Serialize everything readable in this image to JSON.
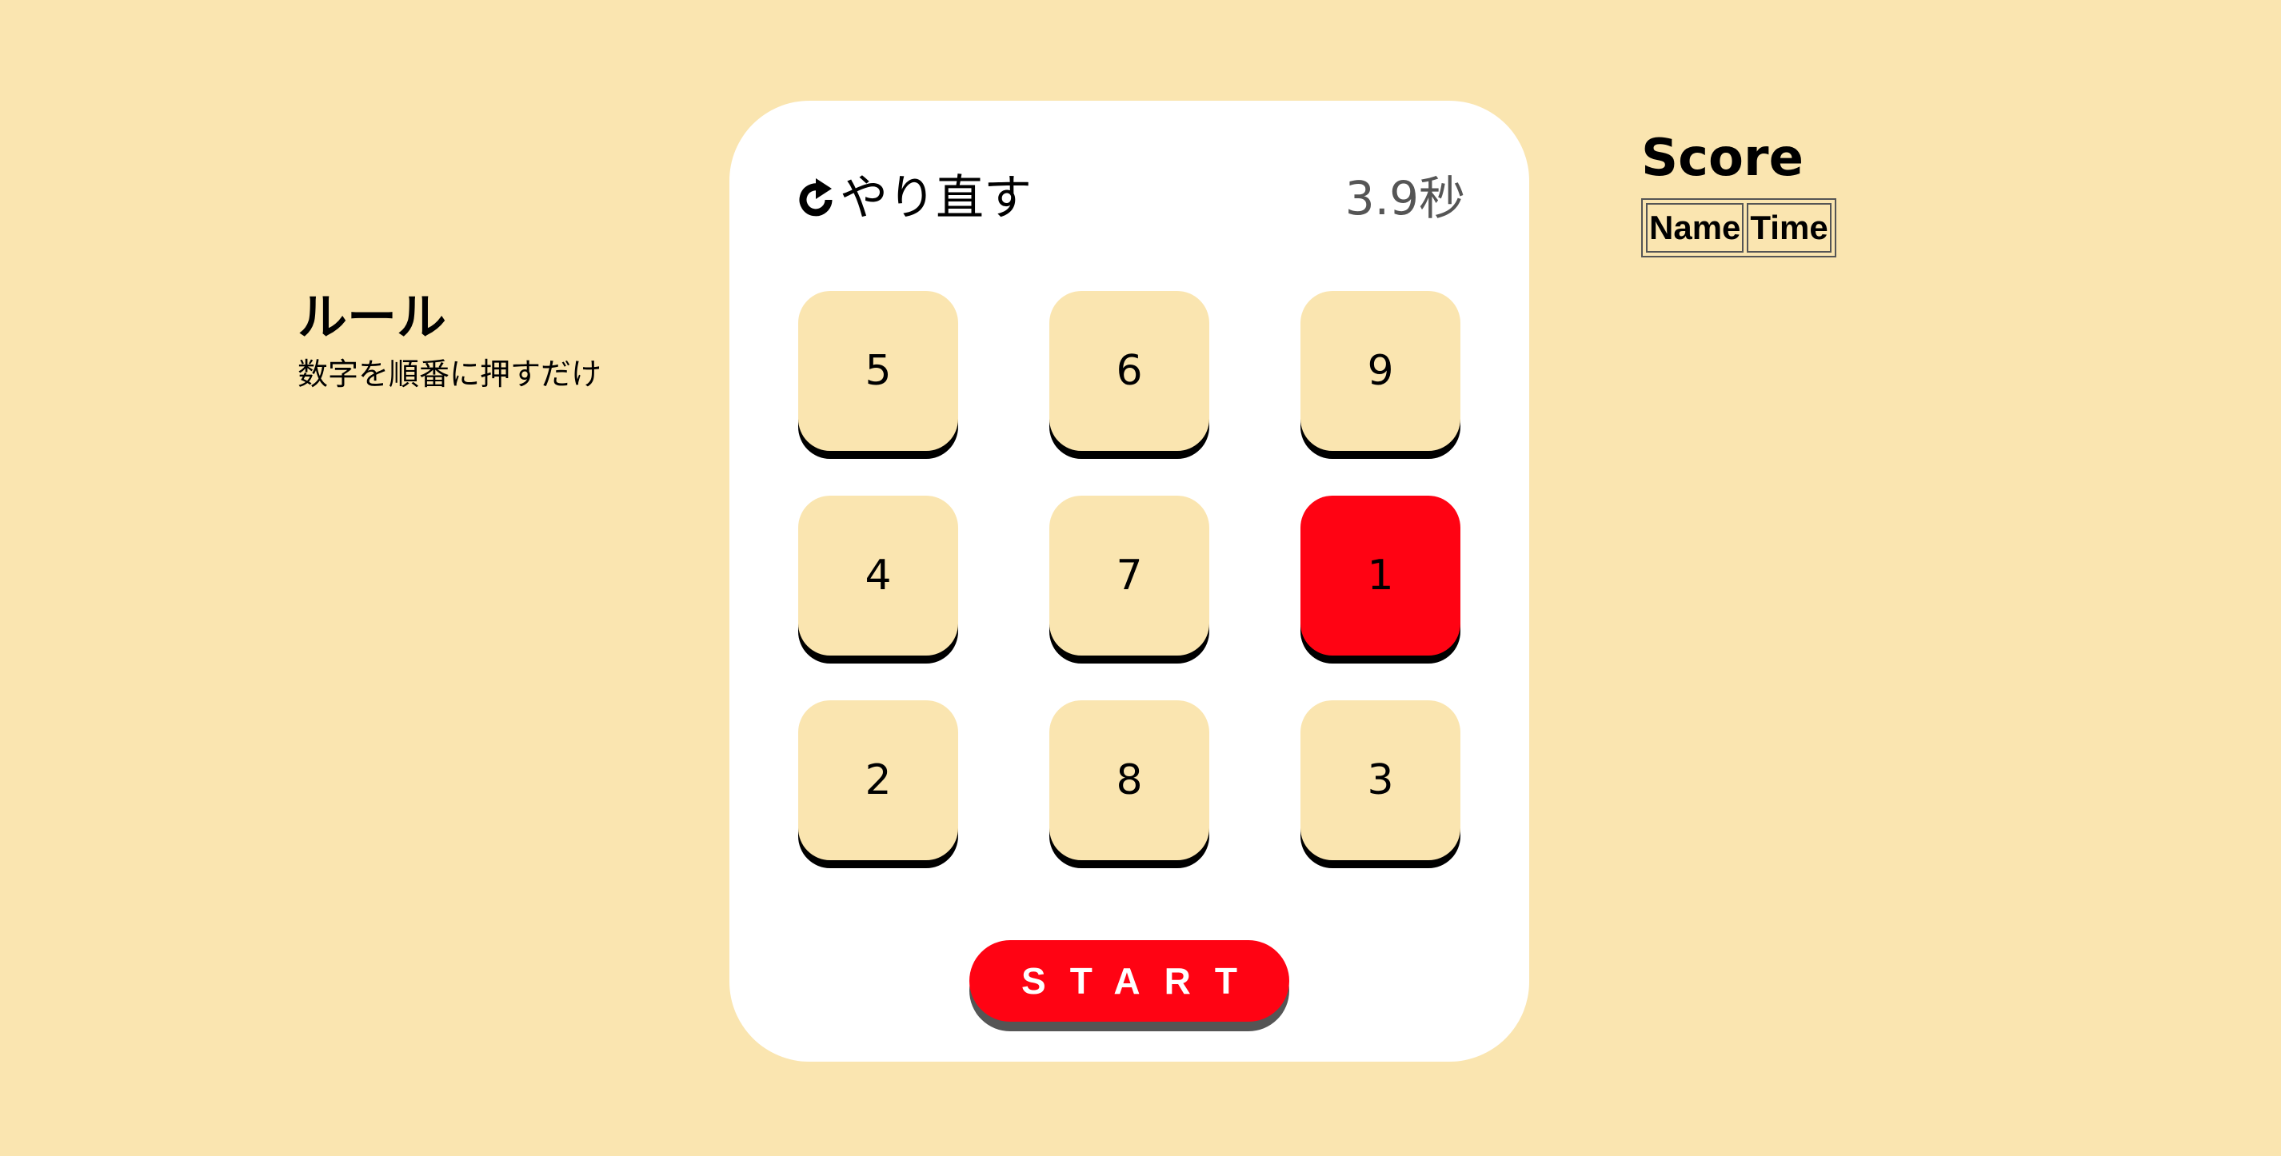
{
  "rules": {
    "title": "ルール",
    "text": "数字を順番に押すだけ"
  },
  "game": {
    "retry_label": "やり直す",
    "retry_icon": "rotate-right-icon",
    "timer": "3.9秒",
    "tiles": [
      "5",
      "6",
      "9",
      "4",
      "7",
      "1",
      "2",
      "8",
      "3"
    ],
    "active_tile": "1",
    "start_label": "START",
    "colors": {
      "background": "#fae5b0",
      "card": "#ffffff",
      "tile": "#fae5b0",
      "tile_active": "#ff0313",
      "start": "#ff0313"
    }
  },
  "score": {
    "title": "Score",
    "columns": [
      "Name",
      "Time"
    ]
  }
}
